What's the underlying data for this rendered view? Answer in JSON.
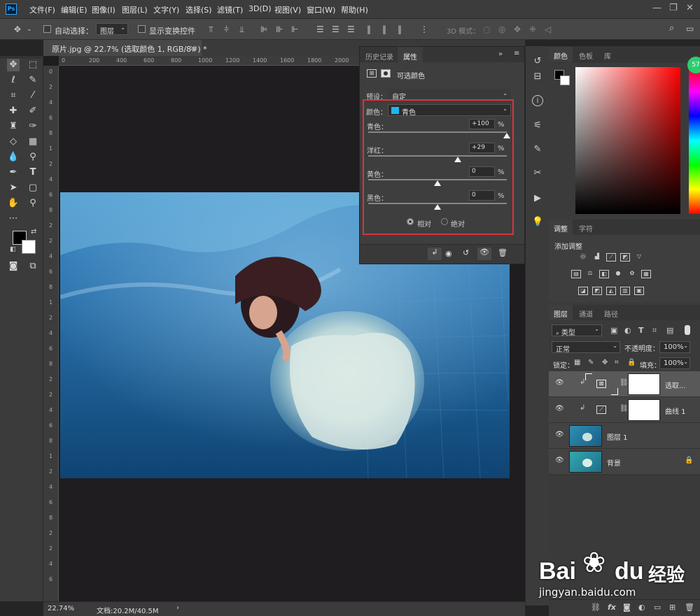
{
  "app": {
    "name": "Ps"
  },
  "menu": [
    "文件(F)",
    "编辑(E)",
    "图像(I)",
    "图层(L)",
    "文字(Y)",
    "选择(S)",
    "滤镜(T)",
    "3D(D)",
    "视图(V)",
    "窗口(W)",
    "帮助(H)"
  ],
  "options": {
    "auto_select_label": "自动选择：",
    "auto_select_value": "图层",
    "show_transform_label": "显示变换控件",
    "mode_3d_label": "3D 模式："
  },
  "document": {
    "tab_title": "原片.jpg @ 22.7% (选取颜色 1, RGB/8#) *",
    "zoom": "22.74%",
    "doc_size": "文档:20.2M/40.5M",
    "ruler_top": [
      "0",
      "200",
      "400",
      "600",
      "800",
      "1000",
      "1200",
      "1400",
      "1600",
      "1800",
      "2000",
      "2"
    ],
    "ruler_left": [
      "0",
      "2",
      "4",
      "6",
      "8",
      "1",
      "2",
      "4",
      "6",
      "8",
      "2",
      "2",
      "4",
      "6",
      "8",
      "1",
      "2",
      "4",
      "6",
      "8",
      "2",
      "2",
      "4",
      "6",
      "8",
      "1",
      "2",
      "4",
      "6",
      "8",
      "2",
      "2",
      "4",
      "6"
    ]
  },
  "properties": {
    "tabs": [
      "历史记录",
      "属性"
    ],
    "header": "可选颜色",
    "preset_label": "预设：",
    "preset_value": "自定",
    "colors_label": "颜色：",
    "colors_value": "青色",
    "colors_swatch": "#1fb6ef",
    "sliders": [
      {
        "label": "青色：",
        "value": "+100",
        "unit": "%",
        "fraction": 1.0
      },
      {
        "label": "洋红：",
        "value": "+29",
        "unit": "%",
        "fraction": 0.645
      },
      {
        "label": "黄色：",
        "value": "0",
        "unit": "%",
        "fraction": 0.5
      },
      {
        "label": "黑色：",
        "value": "0",
        "unit": "%",
        "fraction": 0.5
      }
    ],
    "method_relative": "相对",
    "method_absolute": "绝对",
    "highlight_color": "#d9343c"
  },
  "color_panel": {
    "tabs": [
      "颜色",
      "色板",
      "库"
    ],
    "hue_badge": "57"
  },
  "adjustments": {
    "tabs": [
      "调整",
      "字符"
    ],
    "add_label": "添加调整"
  },
  "layers_panel": {
    "tabs": [
      "图层",
      "通道",
      "路径"
    ],
    "filter_kind": "类型",
    "blend_mode": "正常",
    "opacity_label": "不透明度：",
    "opacity_value": "100%",
    "lock_label": "锁定：",
    "fill_label": "填充：",
    "fill_value": "100%",
    "layers": [
      {
        "name": "选取...",
        "kind": "adjustment"
      },
      {
        "name": "曲线 1",
        "kind": "adjustment"
      },
      {
        "name": "图层 1",
        "kind": "image"
      },
      {
        "name": "背景",
        "kind": "image"
      }
    ]
  },
  "watermark": {
    "brand": "Bai",
    "brand2": "du",
    "cn": "经验",
    "url": "jingyan.baidu.com"
  }
}
